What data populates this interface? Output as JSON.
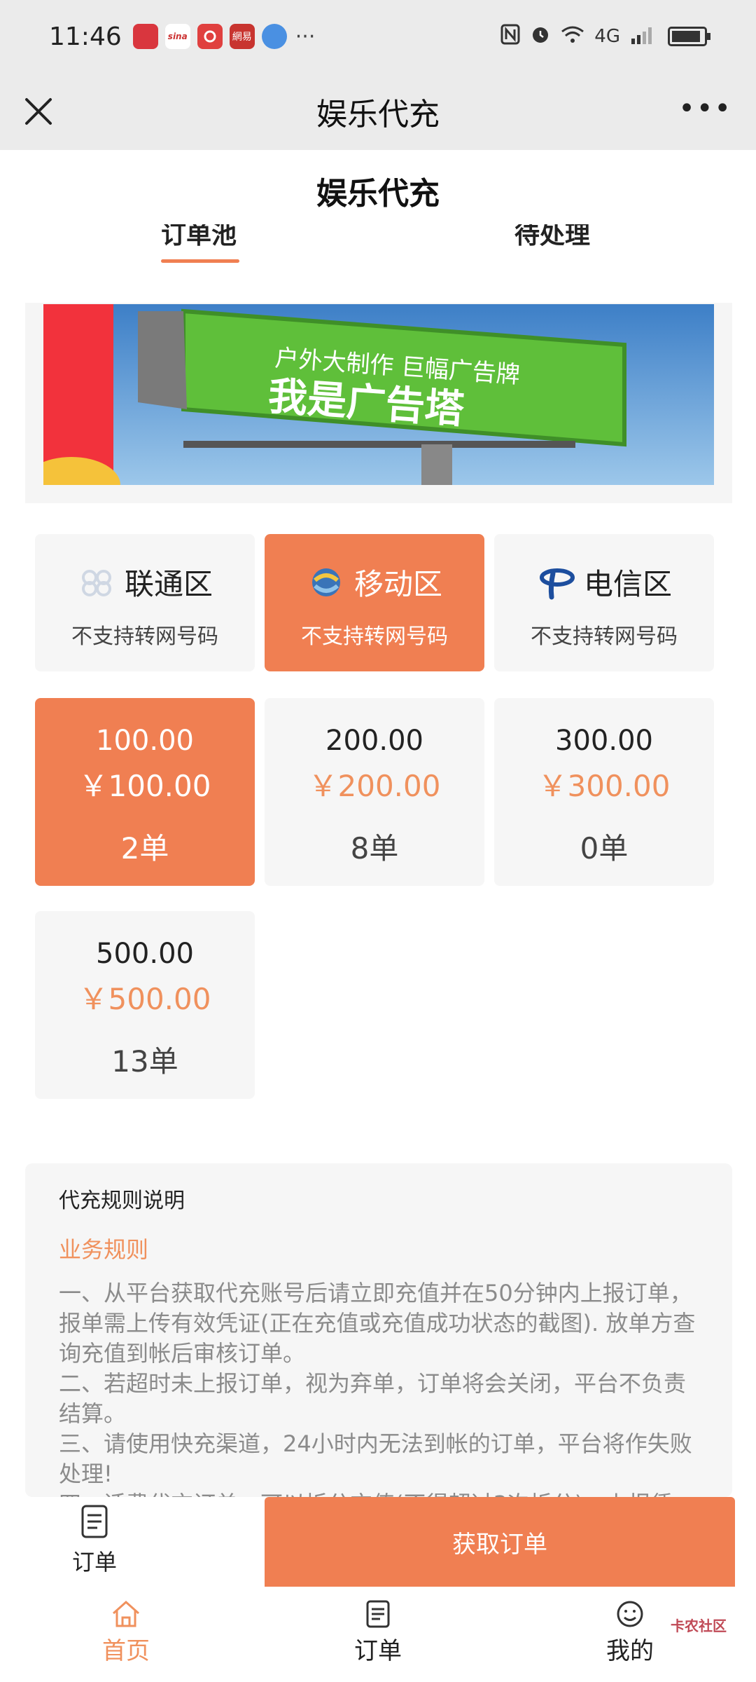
{
  "status_bar": {
    "time": "11:46",
    "apps": [
      {
        "name": "app-icon-1",
        "label": "",
        "color": "#d9363e"
      },
      {
        "name": "app-icon-2",
        "label": "sina",
        "color": "#ffffff"
      },
      {
        "name": "app-icon-3",
        "label": "",
        "color": "#e0403f"
      },
      {
        "name": "app-icon-4",
        "label": "網易",
        "color": "#c8342f"
      },
      {
        "name": "app-icon-5",
        "label": "",
        "color": "#4a90e2"
      }
    ],
    "more": "···",
    "signal_text": "4G"
  },
  "nav": {
    "title": "娱乐代充",
    "more": "•••"
  },
  "page": {
    "title": "娱乐代充",
    "tabs": [
      "订单池",
      "待处理"
    ]
  },
  "banner": {
    "line1": "户外大制作 巨幅广告牌",
    "line2": "我是广告塔"
  },
  "operators": [
    {
      "name": "联通区",
      "sub": "不支持转网号码",
      "icon": "china-unicom-icon"
    },
    {
      "name": "移动区",
      "sub": "不支持转网号码",
      "icon": "china-mobile-icon"
    },
    {
      "name": "电信区",
      "sub": "不支持转网号码",
      "icon": "china-telecom-icon"
    }
  ],
  "amounts": [
    {
      "face": "100.00",
      "price": "￥100.00",
      "count": "2单"
    },
    {
      "face": "200.00",
      "price": "￥200.00",
      "count": "8单"
    },
    {
      "face": "300.00",
      "price": "￥300.00",
      "count": "0单"
    },
    {
      "face": "500.00",
      "price": "￥500.00",
      "count": "13单"
    }
  ],
  "rules": {
    "title": "代充规则说明",
    "subtitle": "业务规则",
    "body": "一、从平台获取代充账号后请立即充值并在50分钟内上报订单，报单需上传有效凭证(正在充值或充值成功状态的截图). 放单方查询充值到帐后审核订单。\n二、若超时未上报订单，视为弃单，订单将会关闭，平台不负责结算。\n三、请使用快充渠道，24小时内无法到帐的订单，平台将作失败处理!\n四、话费代充订单，可以拆分充值(不得超过3次拆分)，上报凭"
  },
  "action": {
    "order_label": "订单",
    "get_order": "获取订单"
  },
  "tabbar": {
    "items": [
      "首页",
      "订单",
      "我的"
    ],
    "watermark": "卡农社区"
  },
  "colors": {
    "accent": "#f07f52",
    "price": "#f0915d"
  }
}
